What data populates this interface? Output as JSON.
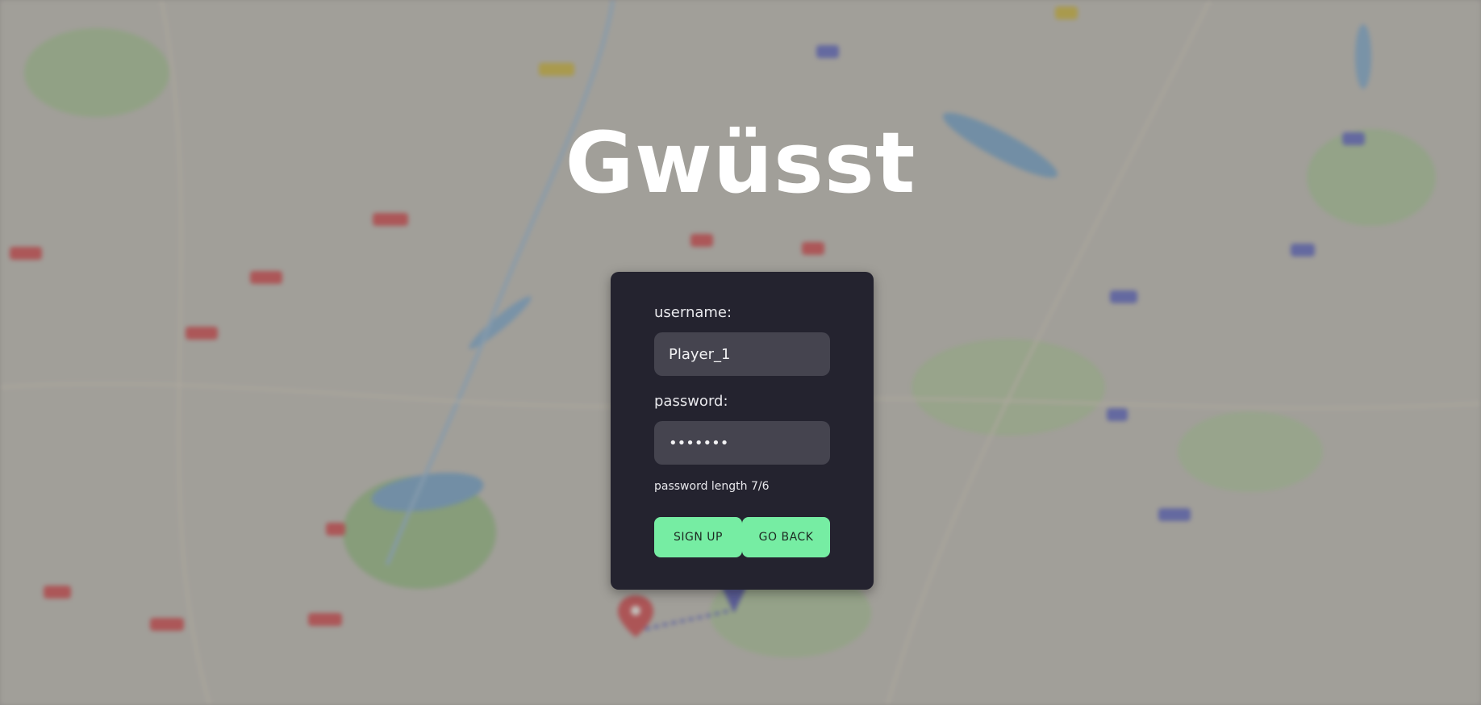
{
  "app": {
    "title": "Gwüsst"
  },
  "signup_form": {
    "username_label": "username:",
    "username_value": "Player_1",
    "password_label": "password:",
    "password_value": "•••••••",
    "password_hint": "password length 7/6",
    "signup_button_label": "SIGN UP",
    "go_back_button_label": "GO BACK"
  },
  "colors": {
    "card_background": "#24232f",
    "input_background": "#45444f",
    "button_accent": "#76eda3",
    "title_text": "#ffffff"
  },
  "background": {
    "description_icon": "map-background"
  }
}
